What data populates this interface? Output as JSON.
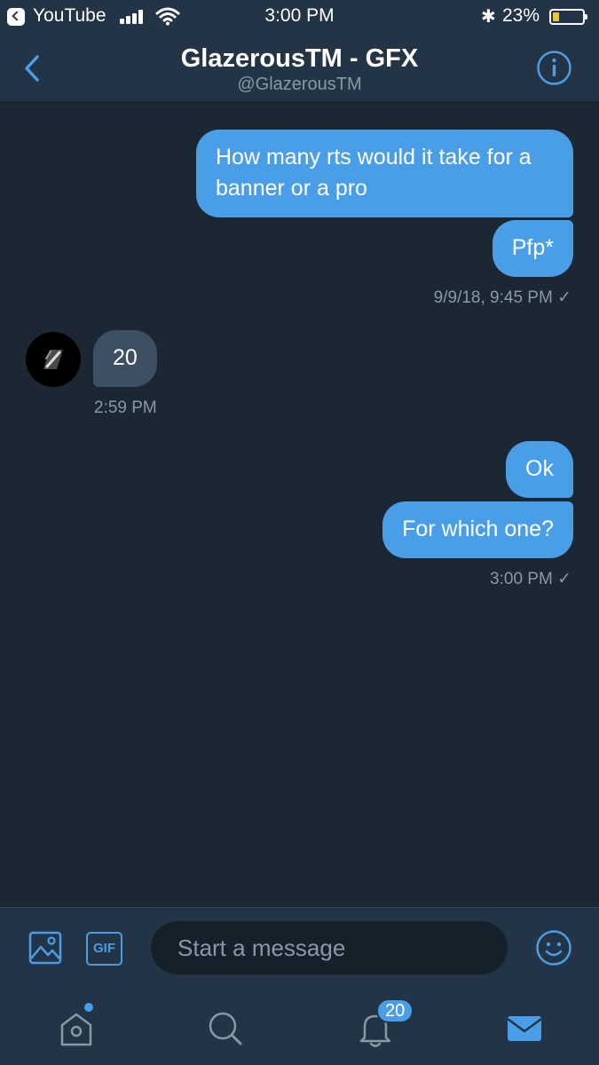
{
  "status_bar": {
    "back_app": "YouTube",
    "time": "3:00 PM",
    "battery_percent": "23%",
    "battery_level": 0.23,
    "icons": [
      "back-to-app-icon",
      "signal-icon",
      "wifi-icon",
      "bluetooth-icon",
      "battery-icon"
    ]
  },
  "header": {
    "title": "GlazerousTM - GFX",
    "handle": "@GlazerousTM",
    "icons": [
      "back-chevron-icon",
      "info-icon"
    ]
  },
  "messages": [
    {
      "from": "me",
      "text": "How many rts would it take for a banner or a pro"
    },
    {
      "from": "me",
      "text": "Pfp*"
    },
    {
      "from": "me",
      "timestamp": "9/9/18, 9:45 PM ✓"
    },
    {
      "from": "them",
      "text": "20"
    },
    {
      "from": "them",
      "timestamp": "2:59 PM"
    },
    {
      "from": "me",
      "text": "Ok"
    },
    {
      "from": "me",
      "text": "For which one?"
    },
    {
      "from": "me",
      "timestamp": "3:00 PM ✓"
    }
  ],
  "composer": {
    "placeholder": "Start a message",
    "gif_label": "GIF",
    "icons": [
      "image-icon",
      "gif-icon",
      "emoji-icon"
    ]
  },
  "tabbar": {
    "notifications_badge": "20",
    "icons": [
      "home-icon",
      "search-icon",
      "notifications-bell-icon",
      "messages-envelope-icon"
    ]
  },
  "colors": {
    "accent": "#4a9ee8",
    "chat_background": "#1c2734",
    "bar_background": "#243447",
    "incoming_bubble": "#3d5063",
    "battery_fill": "#f5c518"
  }
}
